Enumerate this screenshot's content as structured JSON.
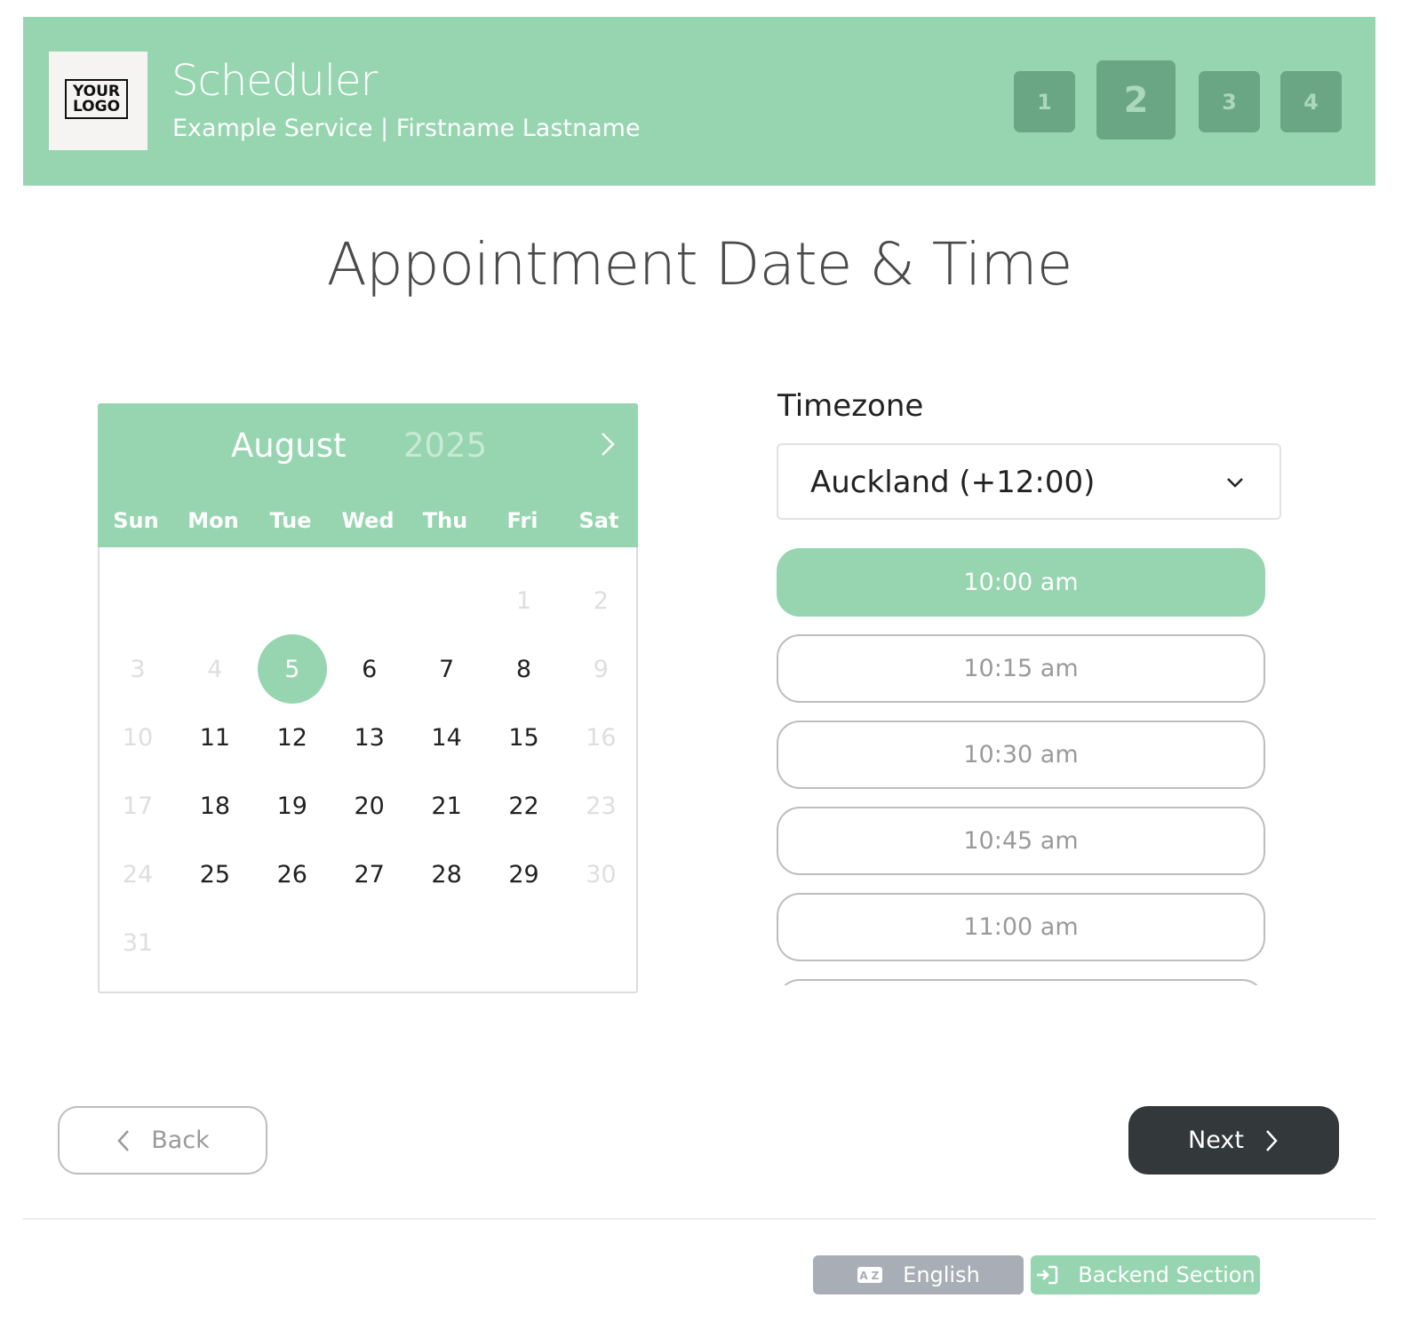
{
  "header": {
    "logo_line1": "YOUR",
    "logo_line2": "LOGO",
    "title": "Scheduler",
    "subtitle": "Example Service | Firstname Lastname",
    "steps": [
      "1",
      "2",
      "3",
      "4"
    ],
    "active_step": "2"
  },
  "page_title": "Appointment Date & Time",
  "calendar": {
    "month": "August",
    "year": "2025",
    "weekdays": [
      "Sun",
      "Mon",
      "Tue",
      "Wed",
      "Thu",
      "Fri",
      "Sat"
    ],
    "selected_day": "5",
    "rows": [
      [
        "",
        "",
        "",
        "",
        "",
        "1",
        "2"
      ],
      [
        "3",
        "4",
        "5",
        "6",
        "7",
        "8",
        "9"
      ],
      [
        "10",
        "11",
        "12",
        "13",
        "14",
        "15",
        "16"
      ],
      [
        "17",
        "18",
        "19",
        "20",
        "21",
        "22",
        "23"
      ],
      [
        "24",
        "25",
        "26",
        "27",
        "28",
        "29",
        "30"
      ],
      [
        "31",
        "",
        "",
        "",
        "",
        "",
        ""
      ]
    ],
    "unavailable_days": [
      "1",
      "2",
      "3",
      "4",
      "9",
      "10",
      "16",
      "17",
      "23",
      "24",
      "30",
      "31"
    ]
  },
  "timezone": {
    "label": "Timezone",
    "value": "Auckland (+12:00)"
  },
  "time_slots": [
    "10:00 am",
    "10:15 am",
    "10:30 am",
    "10:45 am",
    "11:00 am",
    ""
  ],
  "selected_slot": "10:00 am",
  "nav": {
    "back_label": "Back",
    "next_label": "Next"
  },
  "footer": {
    "language_label": "English",
    "backend_label": "Backend Section"
  },
  "colors": {
    "accent": "#96d5b0",
    "step_box": "#6aa584",
    "dark_button": "#33383b",
    "language_pill": "#a8adb6"
  }
}
